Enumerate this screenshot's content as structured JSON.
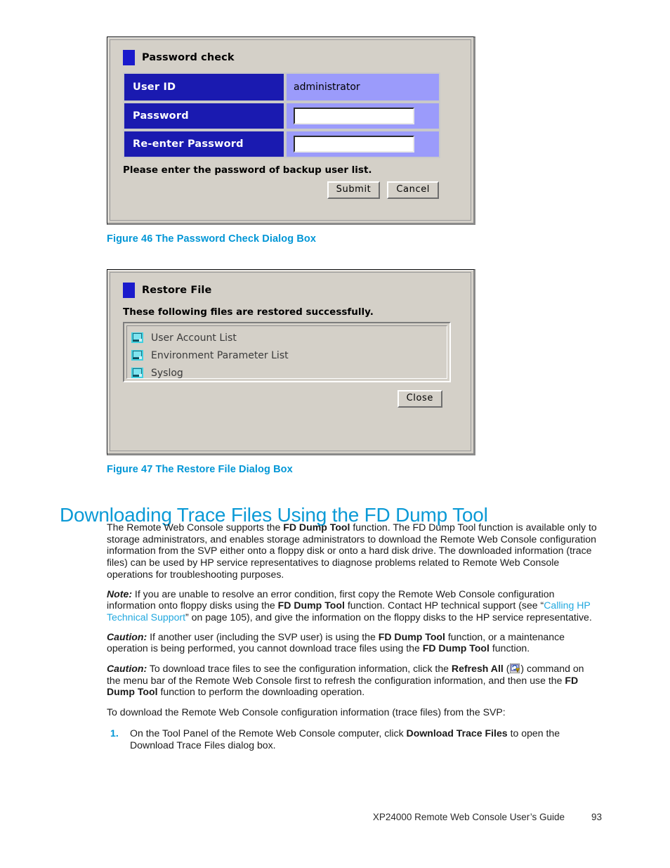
{
  "figure46": {
    "dialog": {
      "title": "Password check",
      "rows": [
        {
          "label": "User ID",
          "value": "administrator",
          "type": "text"
        },
        {
          "label": "Password",
          "value": "",
          "type": "input"
        },
        {
          "label": "Re-enter Password",
          "value": "",
          "type": "input"
        }
      ],
      "message": "Please enter the password of backup user list.",
      "submit_label": "Submit",
      "cancel_label": "Cancel"
    },
    "caption": "Figure 46 The Password Check Dialog Box"
  },
  "figure47": {
    "dialog": {
      "title": "Restore File",
      "message": "These following files are restored successfully.",
      "files": [
        "User Account List",
        "Environment Parameter List",
        "Syslog"
      ],
      "close_label": "Close"
    },
    "caption": "Figure 47 The Restore File Dialog Box"
  },
  "section": {
    "heading": "Downloading Trace Files Using the FD Dump Tool",
    "paragraphs": {
      "intro_1": "The Remote Web Console supports the ",
      "intro_bold_1": "FD Dump Tool",
      "intro_2": " function.  The FD Dump Tool function is available only to storage administrators, and enables storage administrators to download the Remote Web Console configuration information from the SVP either onto a floppy disk or onto a hard disk drive. The downloaded information (trace files) can be used by HP service representatives to diagnose problems related to Remote Web Console operations for troubleshooting purposes.",
      "note_lead": "Note:",
      "note_1": " If you are unable to resolve an error condition, first copy the Remote Web Console configuration information onto floppy disks using the ",
      "note_bold_1": "FD Dump Tool",
      "note_2": " function.  Contact HP technical support (see “",
      "note_link": "Calling HP Technical Support",
      "note_3": "” on page 105), and give the information on the floppy disks to the HP service representative.",
      "caution1_lead": "Caution:",
      "caution1_1": " If another user (including the SVP user) is using the ",
      "caution1_bold_1": "FD Dump Tool",
      "caution1_2": " function, or a maintenance operation is being performed, you cannot download trace files using the ",
      "caution1_bold_2": "FD Dump Tool",
      "caution1_3": " function.",
      "caution2_lead": "Caution:",
      "caution2_1": " To download trace files to see the configuration information, click the ",
      "caution2_bold_1": "Refresh All",
      "caution2_2": " (",
      "caution2_3": ") command on the menu bar of the Remote Web Console first to refresh the configuration information, and then use the ",
      "caution2_bold_2": "FD Dump Tool",
      "caution2_4": " function to perform the downloading operation.",
      "lead_in": "To download the Remote Web Console configuration information (trace files) from the SVP:"
    },
    "steps": [
      {
        "number": "1.",
        "text_1": "On the Tool Panel of the Remote Web Console computer, click ",
        "bold_1": "Download Trace Files",
        "text_2": " to open the Download Trace Files dialog box."
      }
    ]
  },
  "footer": {
    "title": "XP24000 Remote Web Console User’s Guide",
    "page": "93"
  },
  "colors": {
    "accent_cyan": "#0096d6",
    "dialog_header_blue": "#1a1ab0",
    "dialog_value_lavender": "#9b9bfb",
    "dialog_face_gray": "#d4d0c8",
    "file_icon_cyan": "#3fd0e0"
  }
}
